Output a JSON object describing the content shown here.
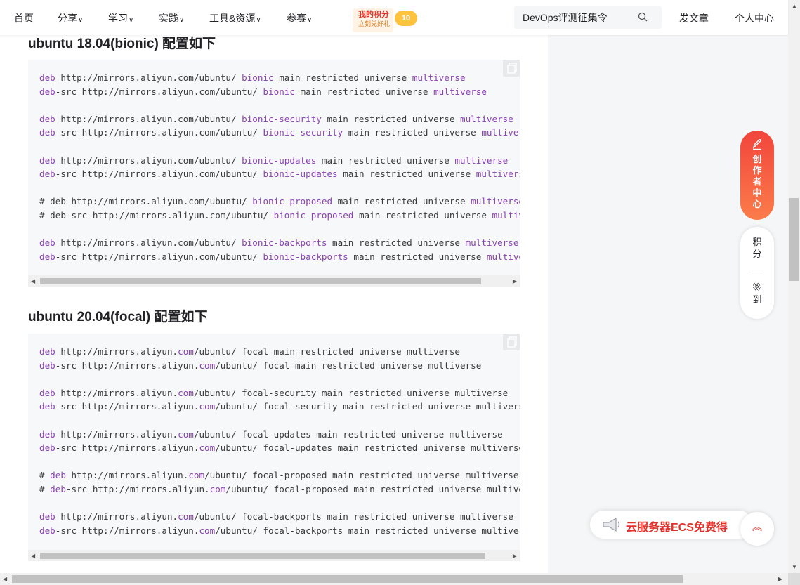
{
  "nav": {
    "items": [
      {
        "label": "首页",
        "dropdown": false
      },
      {
        "label": "分享",
        "dropdown": true
      },
      {
        "label": "学习",
        "dropdown": true
      },
      {
        "label": "实践",
        "dropdown": true
      },
      {
        "label": "工具&资源",
        "dropdown": true
      },
      {
        "label": "参赛",
        "dropdown": true
      }
    ],
    "points_banner": {
      "title": "我的积分",
      "subtitle": "立刻兑好礼",
      "badge": "10"
    },
    "search": {
      "value": "DevOps评测征集令"
    },
    "write_label": "发文章",
    "profile_label": "个人中心"
  },
  "article": {
    "section1": {
      "heading": "ubuntu 18.04(bionic) 配置如下",
      "lines": [
        [
          {
            "t": "deb",
            "c": "kw"
          },
          {
            "t": " http://mirrors.aliyun.com/ubuntu/ "
          },
          {
            "t": "bionic",
            "c": "kw"
          },
          {
            "t": " main restricted universe "
          },
          {
            "t": "multiverse",
            "c": "kw"
          }
        ],
        [
          {
            "t": "deb",
            "c": "kw"
          },
          {
            "t": "-src http://mirrors.aliyun.com/ubuntu/ "
          },
          {
            "t": "bionic",
            "c": "kw"
          },
          {
            "t": " main restricted universe "
          },
          {
            "t": "multiverse",
            "c": "kw"
          }
        ],
        [],
        [
          {
            "t": "deb",
            "c": "kw"
          },
          {
            "t": " http://mirrors.aliyun.com/ubuntu/ "
          },
          {
            "t": "bionic-security",
            "c": "kw"
          },
          {
            "t": " main restricted universe "
          },
          {
            "t": "multiverse",
            "c": "kw"
          }
        ],
        [
          {
            "t": "deb",
            "c": "kw"
          },
          {
            "t": "-src http://mirrors.aliyun.com/ubuntu/ "
          },
          {
            "t": "bionic-security",
            "c": "kw"
          },
          {
            "t": " main restricted universe "
          },
          {
            "t": "multiverse",
            "c": "kw"
          }
        ],
        [],
        [
          {
            "t": "deb",
            "c": "kw"
          },
          {
            "t": " http://mirrors.aliyun.com/ubuntu/ "
          },
          {
            "t": "bionic-updates",
            "c": "kw"
          },
          {
            "t": " main restricted universe "
          },
          {
            "t": "multiverse",
            "c": "kw"
          }
        ],
        [
          {
            "t": "deb",
            "c": "kw"
          },
          {
            "t": "-src http://mirrors.aliyun.com/ubuntu/ "
          },
          {
            "t": "bionic-updates",
            "c": "kw"
          },
          {
            "t": " main restricted universe "
          },
          {
            "t": "multiverse",
            "c": "kw"
          }
        ],
        [],
        [
          {
            "t": "# deb http://mirrors.aliyun.com/ubuntu/ "
          },
          {
            "t": "bionic-proposed",
            "c": "kw"
          },
          {
            "t": " main restricted universe "
          },
          {
            "t": "multiverse",
            "c": "kw"
          }
        ],
        [
          {
            "t": "# deb-src http://mirrors.aliyun.com/ubuntu/ "
          },
          {
            "t": "bionic-proposed",
            "c": "kw"
          },
          {
            "t": " main restricted universe "
          },
          {
            "t": "multiverse",
            "c": "kw"
          }
        ],
        [],
        [
          {
            "t": "deb",
            "c": "kw"
          },
          {
            "t": " http://mirrors.aliyun.com/ubuntu/ "
          },
          {
            "t": "bionic-backports",
            "c": "kw"
          },
          {
            "t": " main restricted universe "
          },
          {
            "t": "multiverse",
            "c": "kw"
          }
        ],
        [
          {
            "t": "deb",
            "c": "kw"
          },
          {
            "t": "-src http://mirrors.aliyun.com/ubuntu/ "
          },
          {
            "t": "bionic-backports",
            "c": "kw"
          },
          {
            "t": " main restricted universe "
          },
          {
            "t": "multiverse",
            "c": "kw"
          }
        ]
      ]
    },
    "section2": {
      "heading": "ubuntu 20.04(focal) 配置如下",
      "lines": [
        [
          {
            "t": "deb",
            "c": "kw"
          },
          {
            "t": " http://mirrors.aliyun."
          },
          {
            "t": "com",
            "c": "kw"
          },
          {
            "t": "/ubuntu/ focal main restricted universe multiverse"
          }
        ],
        [
          {
            "t": "deb",
            "c": "kw"
          },
          {
            "t": "-src http://mirrors.aliyun."
          },
          {
            "t": "com",
            "c": "kw"
          },
          {
            "t": "/ubuntu/ focal main restricted universe multiverse"
          }
        ],
        [],
        [
          {
            "t": "deb",
            "c": "kw"
          },
          {
            "t": " http://mirrors.aliyun."
          },
          {
            "t": "com",
            "c": "kw"
          },
          {
            "t": "/ubuntu/ focal-security main restricted universe multiverse"
          }
        ],
        [
          {
            "t": "deb",
            "c": "kw"
          },
          {
            "t": "-src http://mirrors.aliyun."
          },
          {
            "t": "com",
            "c": "kw"
          },
          {
            "t": "/ubuntu/ focal-security main restricted universe multiverse"
          }
        ],
        [],
        [
          {
            "t": "deb",
            "c": "kw"
          },
          {
            "t": " http://mirrors.aliyun."
          },
          {
            "t": "com",
            "c": "kw"
          },
          {
            "t": "/ubuntu/ focal-updates main restricted universe multiverse"
          }
        ],
        [
          {
            "t": "deb",
            "c": "kw"
          },
          {
            "t": "-src http://mirrors.aliyun."
          },
          {
            "t": "com",
            "c": "kw"
          },
          {
            "t": "/ubuntu/ focal-updates main restricted universe multiverse"
          }
        ],
        [],
        [
          {
            "t": "# "
          },
          {
            "t": "deb",
            "c": "kw"
          },
          {
            "t": " http://mirrors.aliyun."
          },
          {
            "t": "com",
            "c": "kw"
          },
          {
            "t": "/ubuntu/ focal-proposed main restricted universe multiverse"
          }
        ],
        [
          {
            "t": "# "
          },
          {
            "t": "deb",
            "c": "kw"
          },
          {
            "t": "-src http://mirrors.aliyun."
          },
          {
            "t": "com",
            "c": "kw"
          },
          {
            "t": "/ubuntu/ focal-proposed main restricted universe multiverse"
          }
        ],
        [],
        [
          {
            "t": "deb",
            "c": "kw"
          },
          {
            "t": " http://mirrors.aliyun."
          },
          {
            "t": "com",
            "c": "kw"
          },
          {
            "t": "/ubuntu/ focal-backports main restricted universe multiverse"
          }
        ],
        [
          {
            "t": "deb",
            "c": "kw"
          },
          {
            "t": "-src http://mirrors.aliyun."
          },
          {
            "t": "com",
            "c": "kw"
          },
          {
            "t": "/ubuntu/ focal-backports main restricted universe multiverse"
          }
        ]
      ]
    }
  },
  "sidebar": {
    "creator_label": "创作者中心",
    "points_label": "积分",
    "checkin_label": "签到",
    "ecs_ad_label": "云服务器ECS免费得",
    "back_to_top_label": "︽"
  },
  "colors": {
    "keyword": "#8a43b0",
    "accent": "#e0312a",
    "code_bg": "#f6f8fa"
  }
}
